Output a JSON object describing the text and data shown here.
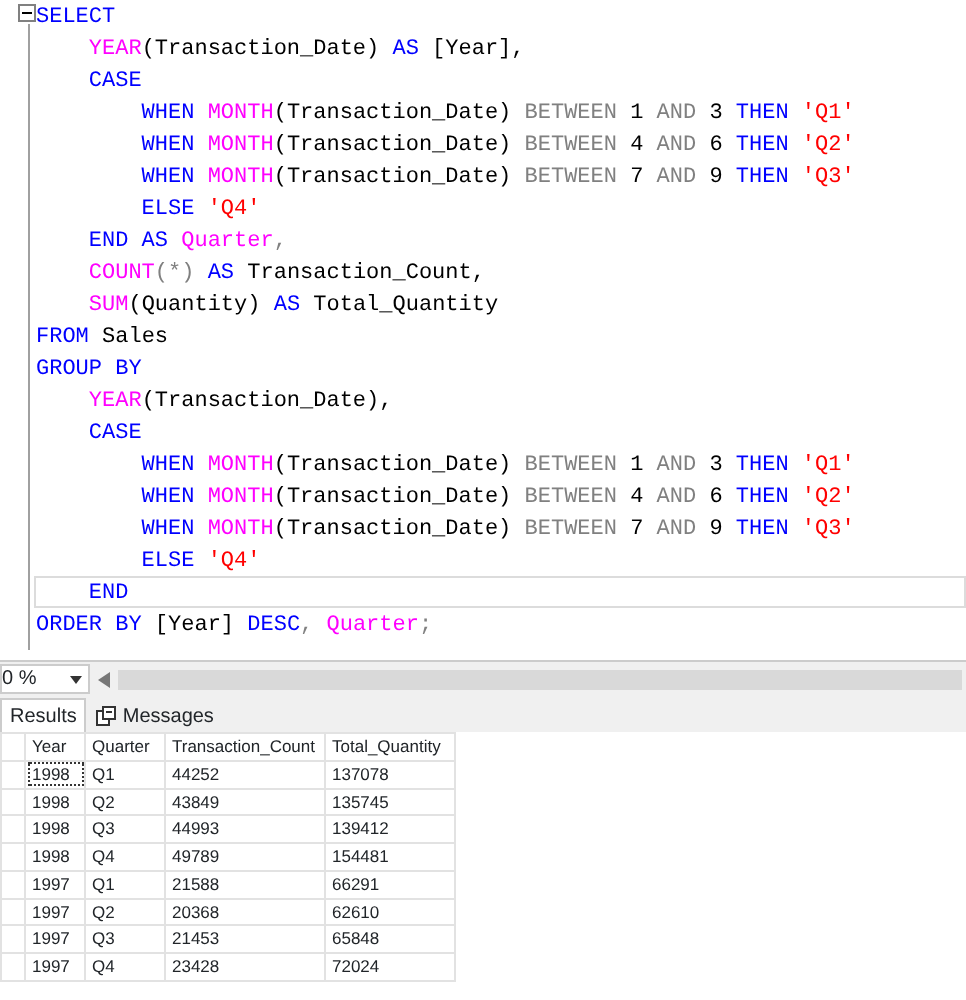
{
  "editor": {
    "lines": [
      {
        "current": false,
        "tokens": [
          {
            "kind": "kw",
            "text": "SELECT"
          }
        ]
      },
      {
        "current": false,
        "tokens": [
          {
            "kind": "fn",
            "text": "    YEAR"
          },
          {
            "kind": "plain",
            "text": "(Transaction_Date) "
          },
          {
            "kind": "kw",
            "text": "AS"
          },
          {
            "kind": "plain",
            "text": " [Year],"
          }
        ]
      },
      {
        "current": false,
        "tokens": [
          {
            "kind": "kw",
            "text": "    CASE"
          }
        ]
      },
      {
        "current": false,
        "tokens": [
          {
            "kind": "kw",
            "text": "        WHEN "
          },
          {
            "kind": "fn",
            "text": "MONTH"
          },
          {
            "kind": "plain",
            "text": "(Transaction_Date) "
          },
          {
            "kind": "op",
            "text": "BETWEEN "
          },
          {
            "kind": "plain",
            "text": "1 "
          },
          {
            "kind": "op",
            "text": "AND "
          },
          {
            "kind": "plain",
            "text": "3 "
          },
          {
            "kind": "kw",
            "text": "THEN "
          },
          {
            "kind": "str",
            "text": "'Q1'"
          }
        ]
      },
      {
        "current": false,
        "tokens": [
          {
            "kind": "kw",
            "text": "        WHEN "
          },
          {
            "kind": "fn",
            "text": "MONTH"
          },
          {
            "kind": "plain",
            "text": "(Transaction_Date) "
          },
          {
            "kind": "op",
            "text": "BETWEEN "
          },
          {
            "kind": "plain",
            "text": "4 "
          },
          {
            "kind": "op",
            "text": "AND "
          },
          {
            "kind": "plain",
            "text": "6 "
          },
          {
            "kind": "kw",
            "text": "THEN "
          },
          {
            "kind": "str",
            "text": "'Q2'"
          }
        ]
      },
      {
        "current": false,
        "tokens": [
          {
            "kind": "kw",
            "text": "        WHEN "
          },
          {
            "kind": "fn",
            "text": "MONTH"
          },
          {
            "kind": "plain",
            "text": "(Transaction_Date) "
          },
          {
            "kind": "op",
            "text": "BETWEEN "
          },
          {
            "kind": "plain",
            "text": "7 "
          },
          {
            "kind": "op",
            "text": "AND "
          },
          {
            "kind": "plain",
            "text": "9 "
          },
          {
            "kind": "kw",
            "text": "THEN "
          },
          {
            "kind": "str",
            "text": "'Q3'"
          }
        ]
      },
      {
        "current": false,
        "tokens": [
          {
            "kind": "kw",
            "text": "        ELSE "
          },
          {
            "kind": "str",
            "text": "'Q4'"
          }
        ]
      },
      {
        "current": false,
        "tokens": [
          {
            "kind": "kw",
            "text": "    END AS "
          },
          {
            "kind": "fn",
            "text": "Quarter"
          },
          {
            "kind": "op",
            "text": ","
          }
        ]
      },
      {
        "current": false,
        "tokens": [
          {
            "kind": "fn",
            "text": "    COUNT"
          },
          {
            "kind": "op",
            "text": "(*) "
          },
          {
            "kind": "kw",
            "text": "AS "
          },
          {
            "kind": "plain",
            "text": "Transaction_Count,"
          }
        ]
      },
      {
        "current": false,
        "tokens": [
          {
            "kind": "fn",
            "text": "    SUM"
          },
          {
            "kind": "plain",
            "text": "(Quantity) "
          },
          {
            "kind": "kw",
            "text": "AS "
          },
          {
            "kind": "plain",
            "text": "Total_Quantity"
          }
        ]
      },
      {
        "current": false,
        "tokens": [
          {
            "kind": "kw",
            "text": "FROM "
          },
          {
            "kind": "plain",
            "text": "Sales"
          }
        ]
      },
      {
        "current": false,
        "tokens": [
          {
            "kind": "kw",
            "text": "GROUP BY"
          }
        ]
      },
      {
        "current": false,
        "tokens": [
          {
            "kind": "fn",
            "text": "    YEAR"
          },
          {
            "kind": "plain",
            "text": "(Transaction_Date),"
          }
        ]
      },
      {
        "current": false,
        "tokens": [
          {
            "kind": "kw",
            "text": "    CASE"
          }
        ]
      },
      {
        "current": false,
        "tokens": [
          {
            "kind": "kw",
            "text": "        WHEN "
          },
          {
            "kind": "fn",
            "text": "MONTH"
          },
          {
            "kind": "plain",
            "text": "(Transaction_Date) "
          },
          {
            "kind": "op",
            "text": "BETWEEN "
          },
          {
            "kind": "plain",
            "text": "1 "
          },
          {
            "kind": "op",
            "text": "AND "
          },
          {
            "kind": "plain",
            "text": "3 "
          },
          {
            "kind": "kw",
            "text": "THEN "
          },
          {
            "kind": "str",
            "text": "'Q1'"
          }
        ]
      },
      {
        "current": false,
        "tokens": [
          {
            "kind": "kw",
            "text": "        WHEN "
          },
          {
            "kind": "fn",
            "text": "MONTH"
          },
          {
            "kind": "plain",
            "text": "(Transaction_Date) "
          },
          {
            "kind": "op",
            "text": "BETWEEN "
          },
          {
            "kind": "plain",
            "text": "4 "
          },
          {
            "kind": "op",
            "text": "AND "
          },
          {
            "kind": "plain",
            "text": "6 "
          },
          {
            "kind": "kw",
            "text": "THEN "
          },
          {
            "kind": "str",
            "text": "'Q2'"
          }
        ]
      },
      {
        "current": false,
        "tokens": [
          {
            "kind": "kw",
            "text": "        WHEN "
          },
          {
            "kind": "fn",
            "text": "MONTH"
          },
          {
            "kind": "plain",
            "text": "(Transaction_Date) "
          },
          {
            "kind": "op",
            "text": "BETWEEN "
          },
          {
            "kind": "plain",
            "text": "7 "
          },
          {
            "kind": "op",
            "text": "AND "
          },
          {
            "kind": "plain",
            "text": "9 "
          },
          {
            "kind": "kw",
            "text": "THEN "
          },
          {
            "kind": "str",
            "text": "'Q3'"
          }
        ]
      },
      {
        "current": false,
        "tokens": [
          {
            "kind": "kw",
            "text": "        ELSE "
          },
          {
            "kind": "str",
            "text": "'Q4'"
          }
        ]
      },
      {
        "current": true,
        "tokens": [
          {
            "kind": "kw",
            "text": "    END"
          }
        ]
      },
      {
        "current": false,
        "tokens": [
          {
            "kind": "kw",
            "text": "ORDER BY "
          },
          {
            "kind": "plain",
            "text": "[Year] "
          },
          {
            "kind": "kw",
            "text": "DESC"
          },
          {
            "kind": "op",
            "text": ", "
          },
          {
            "kind": "fn",
            "text": "Quarter"
          },
          {
            "kind": "op",
            "text": ";"
          }
        ]
      }
    ]
  },
  "zoom": {
    "value": "0 %"
  },
  "results_tabs": [
    {
      "label": "Results",
      "selected": true
    },
    {
      "label": "Messages",
      "selected": false
    }
  ],
  "grid": {
    "columns": [
      "Year",
      "Quarter",
      "Transaction_Count",
      "Total_Quantity"
    ],
    "rows": [
      {
        "focused": true,
        "cells": [
          "1998",
          "Q1",
          "44252",
          "137078"
        ]
      },
      {
        "focused": false,
        "cells": [
          "1998",
          "Q2",
          "43849",
          "135745"
        ]
      },
      {
        "focused": false,
        "cells": [
          "1998",
          "Q3",
          "44993",
          "139412"
        ]
      },
      {
        "focused": false,
        "cells": [
          "1998",
          "Q4",
          "49789",
          "154481"
        ]
      },
      {
        "focused": false,
        "cells": [
          "1997",
          "Q1",
          "21588",
          "66291"
        ]
      },
      {
        "focused": false,
        "cells": [
          "1997",
          "Q2",
          "20368",
          "62610"
        ]
      },
      {
        "focused": false,
        "cells": [
          "1997",
          "Q3",
          "21453",
          "65848"
        ]
      },
      {
        "focused": false,
        "cells": [
          "1997",
          "Q4",
          "23428",
          "72024"
        ]
      }
    ]
  }
}
